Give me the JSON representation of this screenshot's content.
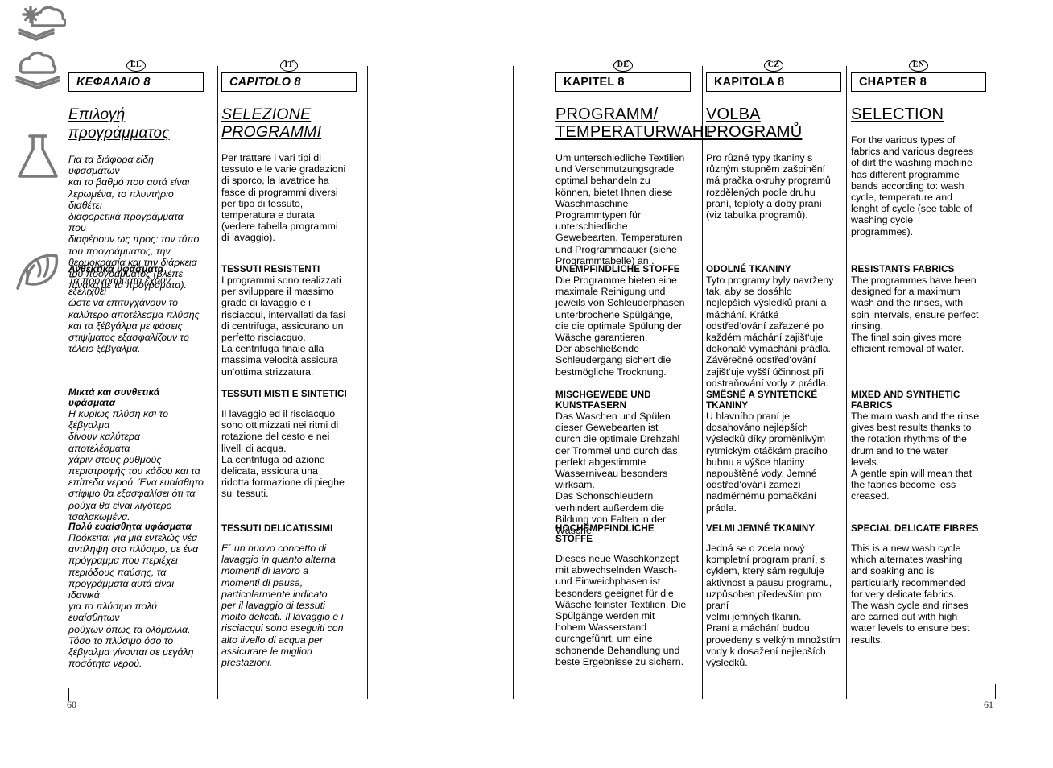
{
  "document": {
    "chapter_number": "8",
    "page_left": "60",
    "page_right": "61"
  },
  "columns": [
    {
      "lang_code": "EL",
      "chapter_label": "KEΦΑΛΑΙΟ 8",
      "title": "Επιλογή\nπρογράμματος",
      "intro": "Για τα διάφορα είδη υφασμάτων\nκαι το βαθμό που αυτά είναι\nλερωμένα, το πλυντήριο διαθέτει\nδιαφορετικά προγράμματα που\nδιαφέρουν ως προς: τον τύπο\nτου προγράμματος, την\nθερμοκρασία και την διάρκεια\nτου προγράμματος (βλέπε\nπίνακα με τα προγράματα).",
      "sections": [
        {
          "heading": "Ανθεκτικά υφάσματα",
          "body": "Τα προγράμματα έχουν εξελιχθεί\nώστε να επιτυγχάνουν το\nκαλύτερο αποτέλεσμα πλύσης\nκαι τα ξέβγάλμα με φάσεις\nστιψίματος εξασφαλίζουν το\nτέλειο ξέβγαλμα."
        },
        {
          "heading": "Μικτά και συνθετικά\nυφάσματα",
          "body": "Η κυρίως πλύση κσι το ξέβγαλμα\nδίνουν καλύτερα αποτελέσματα\nχάριν στους ρυθμούς\nπεριστροφής του κάδου και τα\nεπίπεδα νερού. Ένα ευαίσθητο\nστίφιμο θα εξασφαλίσει ότι τα\nρούχα θα είναι λιγότερο\nτσαλακωμένα."
        },
        {
          "heading": "Πολύ ευαίσθητα υφάσματα",
          "body": "Πρόκειται για μια εντελώς νέα\nαντίληψη στο πλύσιμο, με ένα\nπρόγραμμα που περιέχει\nπεριόδους παύσης, τα\nπρογράμματα αυτά είναι ιδανικά\nγια το πλύσιμο πολύ ευαίσθητων\nρούχων όπως τα ολόμαλλα.\nΤόσο το πλύσιμο όσο το\nξέβγαλμα γίνονται σε μεγάλη\nποσότητα νερού."
        }
      ]
    },
    {
      "lang_code": "IT",
      "chapter_label": "CAPITOLO 8",
      "title": "SELEZIONE\nPROGRAMMI",
      "intro": "Per trattare i vari tipi di\ntessuto e le varie gradazioni\ndi sporco, la lavatrice ha\nfasce di programmi diversi\nper tipo di tessuto,\ntemperatura e durata\n(vedere tabella programmi\ndi lavaggio).",
      "sections": [
        {
          "heading": "TESSUTI RESISTENTI",
          "body": "I programmi sono realizzati\nper sviluppare il massimo\ngrado di lavaggio e i\nrisciacqui, intervallati da fasi\ndi centrifuga, assicurano un\nperfetto risciacquo.\nLa centrifuga finale alla\nmassima velocità assicura\nun’ottima strizzatura."
        },
        {
          "heading": "TESSUTI MISTI E SINTETICI",
          "body": "Il lavaggio ed il risciacquo\nsono ottimizzati nei ritmi di\nrotazione del cesto e nei\nlivelli di acqua.\nLa centrifuga ad azione\ndelicata, assicura una\nridotta formazione di pieghe\nsui tessuti."
        },
        {
          "heading": "TESSUTI DELICATISSIMI",
          "body": "E´ un nuovo concetto di\nlavaggio in quanto alterna\nmomenti di lavoro a\nmomenti di pausa,\nparticolarmente indicato\nper il lavaggio di tessuti\nmolto delicati. Il lavaggio e i\nrisciacqui sono eseguiti con\nalto livello di acqua per\nassicurare le migliori\nprestazioni."
        }
      ]
    },
    {
      "lang_code": "DE",
      "chapter_label": "KAPITEL 8",
      "title": "PROGRAMM/\nTEMPERATURWAHL",
      "intro": "Um unterschiedliche Textilien\nund Verschmutzungsgrade\noptimal behandeln zu\nkönnen, bietet Ihnen diese\nWaschmaschine\nProgrammtypen für\nunterschiedliche\nGewebearten, Temperaturen\nund Programmdauer (siehe\nProgrammtabelle) an .",
      "sections": [
        {
          "heading": "UNEMPFINDLICHE STOFFE",
          "body": "Die Programme bieten eine\nmaximale Reinigung und\njeweils von Schleuderphasen\nunterbrochene Spülgänge,\ndie die optimale Spülung der\nWäsche garantieren.\nDer abschließende\nSchleudergang sichert die\nbestmögliche Trocknung."
        },
        {
          "heading": "MISCHGEWEBE UND\nKUNSTFASERN",
          "body": "Das Waschen und Spülen\ndieser Gewebearten ist\ndurch die optimale Drehzahl\nder Trommel und durch das\nperfekt abgestimmte\nWasserniveau besonders\nwirksam.\nDas Schonschleudern\nverhindert außerdem die\nBildung von Falten in der\nWäsche."
        },
        {
          "heading": "HOCHEMPFINDLICHE STOFFE",
          "body": "Dieses neue Waschkonzept\nmit abwechselnden Wasch-\nund Einweichphasen ist\nbesonders geeignet für die\nWäsche feinster Textilien. Die\nSpülgänge werden mit\nhohem Wasserstand\ndurchgeführt, um eine\nschonende Behandlung und\nbeste Ergebnisse zu sichern."
        }
      ]
    },
    {
      "lang_code": "CZ",
      "chapter_label": "KAPITOLA 8",
      "title": "VOLBA PROGRAMŮ",
      "intro": "Pro různé  typy tkaniny s\nrůzným stupněm zašpinění\nmá pračka okruhy programů\nrozdělených podle druhu\npraní, teploty a doby praní\n(viz tabulka programů).",
      "sections": [
        {
          "heading": "ODOLNÉ TKANINY",
          "body": "Tyto programy byly navrženy\ntak, aby se dosáhlo\nnejlepších výsledků praní a\nmáchání. Krátké\nodstřed‘ování zařazené po\nkaždém máchání zajišt‘uje\ndokonalé vymáchání prádla.\nZávěrečné odstřed‘ování\nzajišt‘uje vyšší účinnost při\nodstraňování vody z prádla."
        },
        {
          "heading": "SMĚSNÉ A SYNTETICKÉ\nTKANINY",
          "body": "U hlavního praní je\ndosahováno nejlepších\nvýsledků díky proměnlivým\nrytmickým otáčkám pracího\nbubnu a výšce hladiny\nnapouštěné vody. Jemné\nodstřed‘ování zamezí\nnadměrnému pomačkání\nprádla."
        },
        {
          "heading": "VELMI JEMNÉ TKANINY",
          "body": "Jedná se o zcela nový\nkompletní program praní, s\ncyklem, který sám reguluje\naktivnost a pausu programu,\nuzpůsoben především pro praní\nvelmi jemných tkanin.\nPraní a máchání budou\nprovedeny s velkým množstím\nvody k dosažení nejlepších\nvýsledků."
        }
      ]
    },
    {
      "lang_code": "EN",
      "chapter_label": "CHAPTER 8",
      "title": "SELECTION",
      "intro": "For the various types of\nfabrics and various degrees\nof dirt the washing machine\nhas different programme\nbands according to: wash\ncycle, temperature and\nlenght of cycle (see table of\nwashing cycle\nprogrammes).",
      "sections": [
        {
          "heading": "RESISTANTS FABRICS",
          "body": "The programmes have been\ndesigned for a maximum\nwash and the rinses, with\nspin intervals, ensure perfect\nrinsing.\nThe final spin gives more\nefficient removal of water."
        },
        {
          "heading": "MIXED AND SYNTHETIC\nFABRICS",
          "body": "The main wash and the rinse\ngives best results thanks to\nthe rotation rhythms of the\ndrum and to the water\nlevels.\nA gentle spin will mean that\nthe fabrics become less\ncreased."
        },
        {
          "heading": "SPECIAL DELICATE FIBRES",
          "body": "This is a new wash cycle\nwhich alternates washing\nand soaking and is\nparticularly recommended\nfor very delicate fabrics.\nThe wash cycle and rinses\nare carried out with high\nwater levels to ensure best\nresults."
        }
      ]
    }
  ],
  "icons": [
    {
      "name": "sun-cloud-fabric-icon",
      "label": "resistant fabrics symbol"
    },
    {
      "name": "cloud-fabric-icon",
      "label": "mixed fabrics symbol"
    },
    {
      "name": "flask-icon",
      "label": "synthetic fabrics symbol"
    },
    {
      "name": "feather-icon",
      "label": "delicate fabrics symbol"
    }
  ],
  "colors": {
    "ink": "#000000",
    "icon_gray": "#7a7a7a",
    "rule": "#1a1a1a"
  }
}
